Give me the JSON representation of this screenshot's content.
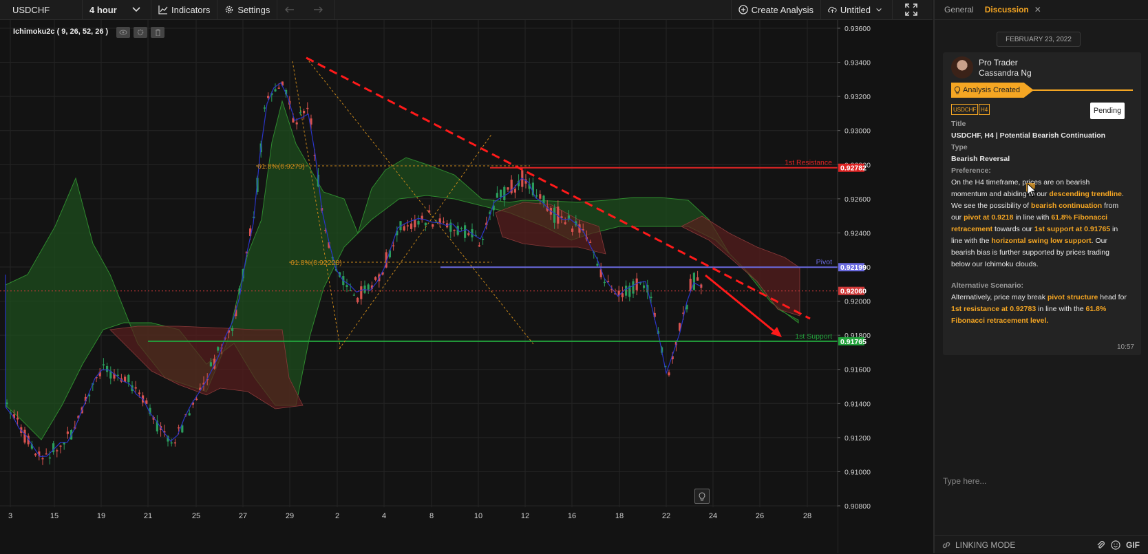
{
  "topbar": {
    "symbol": "USDCHF",
    "timeframe": "4 hour",
    "indicators": "Indicators",
    "settings": "Settings",
    "create_analysis": "Create Analysis",
    "layout_name": "Untitled"
  },
  "chart": {
    "indicator_label": "Ichimoku2c ( 9, 26, 52, 26 )",
    "price_ticks": [
      "0.93600",
      "0.93400",
      "0.93200",
      "0.93000",
      "0.92800",
      "0.92600",
      "0.92400",
      "0.92200",
      "0.92000",
      "0.91800",
      "0.91600",
      "0.91400",
      "0.91200",
      "0.91000",
      "0.90800"
    ],
    "date_ticks": [
      "3",
      "15",
      "19",
      "21",
      "25",
      "27",
      "29",
      "2",
      "4",
      "8",
      "10",
      "12",
      "16",
      "18",
      "22",
      "24",
      "26",
      "28"
    ],
    "levels": {
      "resistance": {
        "label": "1st Resistance",
        "value": "0.92782"
      },
      "pivot": {
        "label": "Pivot",
        "value": "0.92199"
      },
      "current": {
        "value": "0.92060"
      },
      "support": {
        "label": "1st Support",
        "value": "0.91765"
      }
    },
    "fib_labels": [
      "61.8%(0.9279)",
      "61.8%(0.92228)"
    ],
    "colors": {
      "resistance": "#e02424",
      "pivot": "#6a6adf",
      "support": "#22a33c",
      "fib": "#c8871a",
      "trend": "#ff1a1a",
      "up": "#26a269",
      "down": "#e05a5a"
    }
  },
  "panel": {
    "tabs": [
      "General",
      "Discussion"
    ],
    "active_tab": "Discussion",
    "date": "FEBRUARY 23, 2022",
    "author_title": "Pro Trader",
    "author_name": "Cassandra Ng",
    "status_badge": "Analysis Created",
    "tags": [
      "USDCHF",
      "H4"
    ],
    "pending": "Pending",
    "title_label": "Title",
    "title": "USDCHF, H4 | Potential Bearish Continuation",
    "type_label": "Type",
    "type": "Bearish Reversal",
    "preference_label": "Preference:",
    "preference": {
      "p1": "On the H4 timeframe, prices are on bearish momentum and abiding to our ",
      "h1": "descending trendline",
      "p2": ". We see the possibility of ",
      "h2": "bearish continuation",
      "p3": " from our ",
      "h3": "pivot at 0.9218",
      "p4": " in line with ",
      "h4": "61.8% Fibonacci retracement",
      "p5": " towards our ",
      "h5": "1st support at 0.91765",
      "p6": " in line with the ",
      "h6": "horizontal swing low support",
      "p7": ". Our bearish bias is further supported by prices trading below our Ichimoku clouds."
    },
    "alt_label": "Alternative Scenario:",
    "alt": {
      "p1": "Alternatively, price may break ",
      "h1": "pivot structure",
      "p2": " head for ",
      "h2": "1st resistance at 0.92783",
      "p3": " in line with the ",
      "h3": "61.8% Fibonacci retracement level."
    },
    "time": "10:57",
    "input_placeholder": "Type here...",
    "linking_mode": "LINKING MODE",
    "gif": "GIF"
  }
}
